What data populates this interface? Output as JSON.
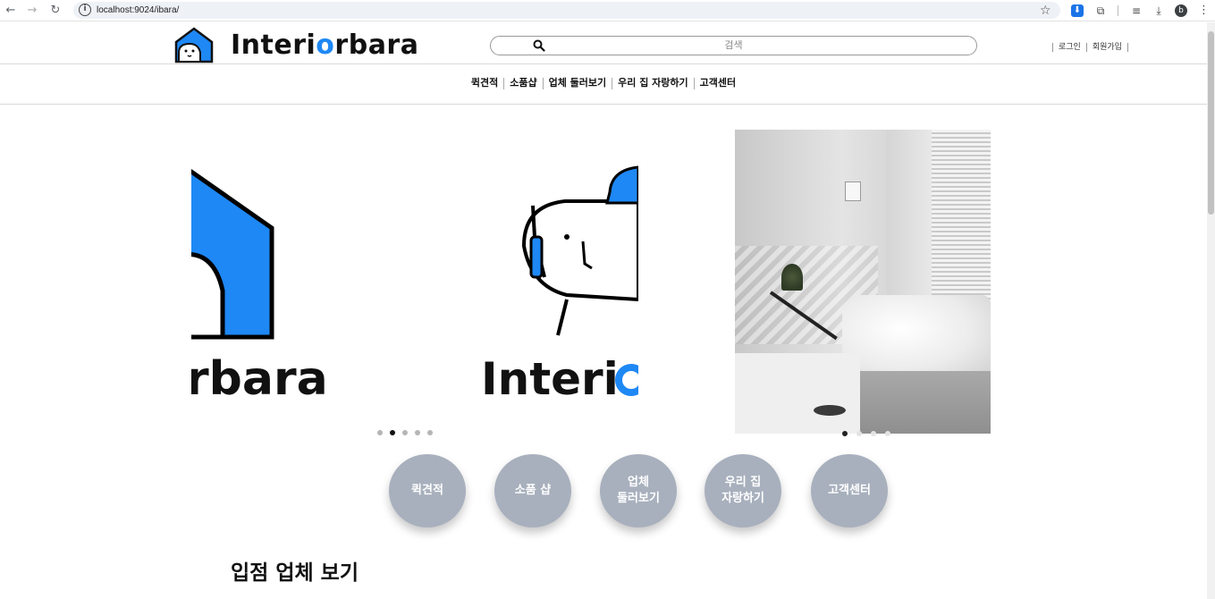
{
  "browser": {
    "url": "localhost:9024/ibara/",
    "back_icon": "arrow-left-icon",
    "forward_icon": "arrow-right-icon",
    "reload_icon": "reload-icon",
    "avatar_letter": "b"
  },
  "header": {
    "logo_text_before": "Interi",
    "logo_text_o": "o",
    "logo_text_after": "rbara",
    "search_placeholder": "검색",
    "login": "로그인",
    "signup": "회원가입",
    "brand_color": "#1e88f5"
  },
  "nav": {
    "items": [
      "퀵견적",
      "소품샵",
      "업체 둘러보기",
      "우리 집 자랑하기",
      "고객센터"
    ]
  },
  "slider": {
    "slide1_text": "rbara",
    "slide2_text": "Interi",
    "dot_count": 5,
    "active_dot": 2
  },
  "categories": [
    {
      "label": "퀵견적"
    },
    {
      "label": "소품 샵"
    },
    {
      "label": "업체\n둘러보기"
    },
    {
      "label": "우리 집\n자랑하기"
    },
    {
      "label": "고객센터"
    }
  ],
  "section": {
    "title": "입점 업체 보기"
  }
}
